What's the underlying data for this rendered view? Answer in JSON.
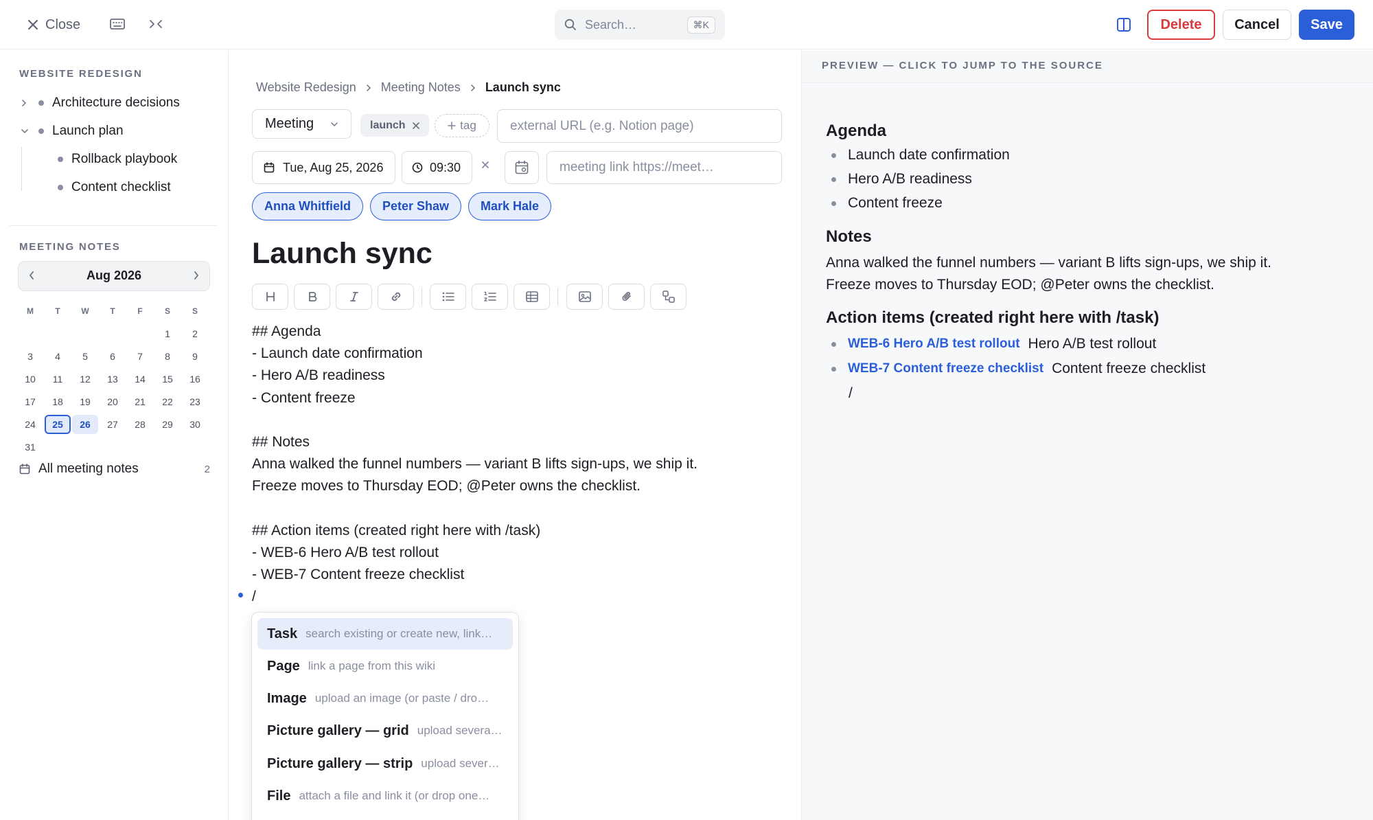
{
  "topbar": {
    "close_label": "Close",
    "search_placeholder": "Search…",
    "search_shortcut": "⌘K",
    "delete_label": "Delete",
    "cancel_label": "Cancel",
    "save_label": "Save",
    "accent_color": "#2b5fd9",
    "danger_color": "#d93a3a"
  },
  "sidebar": {
    "section_title": "WEBSITE REDESIGN",
    "tree": [
      {
        "label": "Architecture decisions",
        "expanded": false
      },
      {
        "label": "Launch plan",
        "expanded": true
      },
      {
        "label": "Rollback playbook"
      },
      {
        "label": "Content checklist"
      }
    ],
    "meeting_title": "MEETING NOTES",
    "calendar": {
      "month": "Aug 2026",
      "weekdays": [
        "M",
        "T",
        "W",
        "T",
        "F",
        "S",
        "S"
      ],
      "leading_blanks": 5,
      "days": 31,
      "selected_day": 25,
      "highlighted_day": 26
    },
    "all_notes_label": "All meeting notes",
    "all_notes_count": "2"
  },
  "editor": {
    "breadcrumb": [
      "Website Redesign",
      "Meeting Notes",
      "Launch sync"
    ],
    "type": "Meeting",
    "tag": "launch",
    "add_tag_label": "tag",
    "external_url_placeholder": "external URL (e.g. Notion page)",
    "date": "Tue, Aug 25, 2026",
    "time": "09:30",
    "meeting_link_placeholder": "meeting link https://meet…",
    "attendees": [
      "Anna Whitfield",
      "Peter Shaw",
      "Mark Hale"
    ],
    "title": "Launch sync",
    "lines": [
      "## Agenda",
      "- Launch date confirmation",
      "- Hero A/B readiness",
      "- Content freeze",
      "",
      "## Notes",
      "Anna walked the funnel numbers — variant B lifts sign-ups, we ship it.",
      "Freeze moves to Thursday EOD; @Peter owns the checklist.",
      "",
      "## Action items (created right here with /task)",
      "- WEB-6 Hero A/B test rollout",
      "- WEB-7 Content freeze checklist",
      "/"
    ]
  },
  "slash_menu": {
    "items": [
      {
        "name": "Task",
        "desc": "search existing or create new, link…"
      },
      {
        "name": "Page",
        "desc": "link a page from this wiki"
      },
      {
        "name": "Image",
        "desc": "upload an image (or paste / dro…"
      },
      {
        "name": "Picture gallery — grid",
        "desc": "upload several…"
      },
      {
        "name": "Picture gallery — strip",
        "desc": "upload severa…"
      },
      {
        "name": "File",
        "desc": "attach a file and link it (or drop one…"
      }
    ]
  },
  "preview": {
    "header": "PREVIEW — CLICK TO JUMP TO THE SOURCE",
    "agenda_heading": "Agenda",
    "agenda_items": [
      "Launch date confirmation",
      "Hero A/B readiness",
      "Content freeze"
    ],
    "notes_heading": "Notes",
    "notes_lines": [
      "Anna walked the funnel numbers — variant B lifts sign-ups, we ship it.",
      "Freeze moves to Thursday EOD; @Peter owns the checklist."
    ],
    "actions_heading": "Action items (created right here with /task)",
    "action_items": [
      {
        "link": "WEB-6 Hero A/B test rollout",
        "text": "Hero A/B test rollout"
      },
      {
        "link": "WEB-7 Content freeze checklist",
        "text": "Content freeze checklist"
      }
    ],
    "trailing": "/"
  }
}
